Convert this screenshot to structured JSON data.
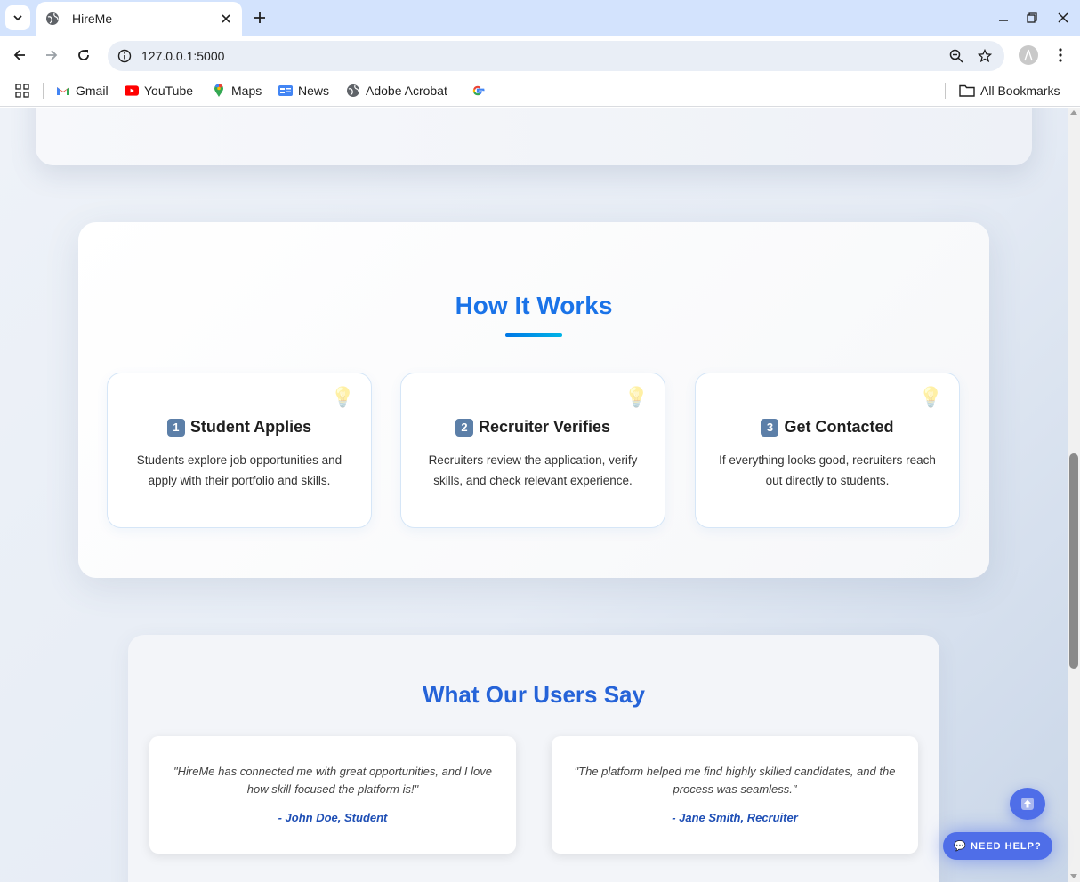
{
  "browser": {
    "tab_title": "HireMe",
    "url": "127.0.0.1:5000",
    "bookmarks": [
      {
        "label": "Gmail",
        "icon": "gmail-icon"
      },
      {
        "label": "YouTube",
        "icon": "youtube-icon"
      },
      {
        "label": "Maps",
        "icon": "maps-icon"
      },
      {
        "label": "News",
        "icon": "news-icon"
      },
      {
        "label": "Adobe Acrobat",
        "icon": "globe-icon"
      }
    ],
    "all_bookmarks_label": "All Bookmarks"
  },
  "how_it_works": {
    "title": "How It Works",
    "steps": [
      {
        "number": "1",
        "title": "Student Applies",
        "description": "Students explore job opportunities and apply with their portfolio and skills."
      },
      {
        "number": "2",
        "title": "Recruiter Verifies",
        "description": "Recruiters review the application, verify skills, and check relevant experience."
      },
      {
        "number": "3",
        "title": "Get Contacted",
        "description": "If everything looks good, recruiters reach out directly to students."
      }
    ]
  },
  "testimonials": {
    "title": "What Our Users Say",
    "items": [
      {
        "quote": "\"HireMe has connected me with great opportunities, and I love how skill-focused the platform is!\"",
        "author": "- John Doe, Student"
      },
      {
        "quote": "\"The platform helped me find highly skilled candidates, and the process was seamless.\"",
        "author": "- Jane Smith, Recruiter"
      }
    ]
  },
  "help_button_label": "💬 NEED HELP?",
  "colors": {
    "accent": "#1a73e8",
    "testimonial_title": "#2563d8",
    "help_button": "#4f6ee8"
  }
}
